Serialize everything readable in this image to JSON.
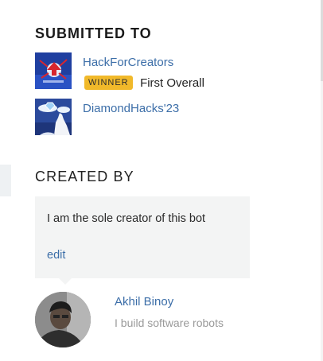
{
  "submitted": {
    "heading": "SUBMITTED TO",
    "hackathons": [
      {
        "name": "HackForCreators",
        "thumbnail_icon": "hackforcreators-logo",
        "prize_badge": "WINNER",
        "prize_name": "First Overall"
      },
      {
        "name": "DiamondHacks'23",
        "thumbnail_icon": "diamondhacks-logo"
      }
    ]
  },
  "created": {
    "heading": "CREATED BY",
    "note": "I am the sole creator of this bot",
    "edit_label": "edit",
    "members": [
      {
        "name": "Akhil Binoy",
        "bio": "I build software robots",
        "avatar_icon": "member-avatar"
      }
    ]
  },
  "colors": {
    "link": "#3c6ea8",
    "badge": "#f1b92a",
    "panel": "#f3f4f4",
    "muted": "#9a9a9a"
  }
}
